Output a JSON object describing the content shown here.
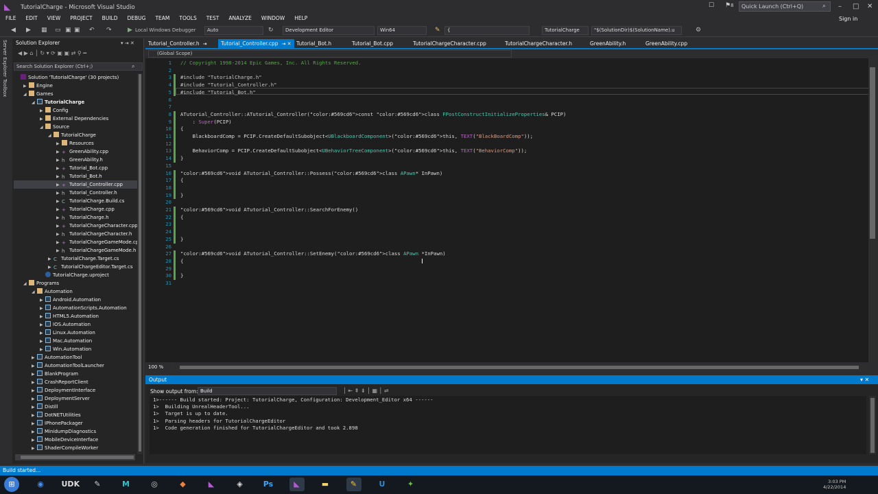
{
  "window": {
    "title": "TutorialCharge - Microsoft Visual Studio",
    "quick_launch": "Quick Launch (Ctrl+Q)",
    "notif_count": "8"
  },
  "menu": [
    "FILE",
    "EDIT",
    "VIEW",
    "PROJECT",
    "BUILD",
    "DEBUG",
    "TEAM",
    "TOOLS",
    "TEST",
    "ANALYZE",
    "WINDOW",
    "HELP"
  ],
  "sign_in": "Sign in",
  "toolbar": {
    "debugger": "Local Windows Debugger",
    "config": "Auto",
    "solution_config": "Development Editor",
    "platform": "Win64",
    "find": "{",
    "project": "TutorialCharge",
    "macro": "\"$(SolutionDir)$(SolutionName).u"
  },
  "side_strip": [
    "Server Explorer",
    "Toolbox"
  ],
  "solution_explorer": {
    "title": "Solution Explorer",
    "search_placeholder": "Search Solution Explorer (Ctrl+;)",
    "nodes": [
      {
        "label": "Solution 'TutorialCharge' (30 projects)",
        "icon": "sln",
        "depth": 0,
        "exp": ""
      },
      {
        "label": "Engine",
        "icon": "folder",
        "depth": 1,
        "exp": "▶"
      },
      {
        "label": "Games",
        "icon": "folder",
        "depth": 1,
        "exp": "◢"
      },
      {
        "label": "TutorialCharge",
        "icon": "proj",
        "depth": 2,
        "exp": "◢",
        "bold": true
      },
      {
        "label": "Config",
        "icon": "folder",
        "depth": 3,
        "exp": "▶"
      },
      {
        "label": "External Dependencies",
        "icon": "folder",
        "depth": 3,
        "exp": "▶"
      },
      {
        "label": "Source",
        "icon": "folder",
        "depth": 3,
        "exp": "◢"
      },
      {
        "label": "TutorialCharge",
        "icon": "folder",
        "depth": 4,
        "exp": "◢"
      },
      {
        "label": "Resources",
        "icon": "folder",
        "depth": 5,
        "exp": "▶"
      },
      {
        "label": "GreenAbility.cpp",
        "icon": "cpp",
        "depth": 5,
        "exp": "▶"
      },
      {
        "label": "GreenAbility.h",
        "icon": "h",
        "depth": 5,
        "exp": "▶"
      },
      {
        "label": "Tutorial_Bot.cpp",
        "icon": "cpp",
        "depth": 5,
        "exp": "▶"
      },
      {
        "label": "Tutorial_Bot.h",
        "icon": "h",
        "depth": 5,
        "exp": "▶"
      },
      {
        "label": "Tutorial_Controller.cpp",
        "icon": "cpp",
        "depth": 5,
        "exp": "▶",
        "selected": true
      },
      {
        "label": "Tutorial_Controller.h",
        "icon": "h",
        "depth": 5,
        "exp": "▶"
      },
      {
        "label": "TutorialCharge.Build.cs",
        "icon": "cs",
        "depth": 5,
        "exp": "▶"
      },
      {
        "label": "TutorialCharge.cpp",
        "icon": "cpp",
        "depth": 5,
        "exp": "▶"
      },
      {
        "label": "TutorialCharge.h",
        "icon": "h",
        "depth": 5,
        "exp": "▶"
      },
      {
        "label": "TutorialChargeCharacter.cpp",
        "icon": "cpp",
        "depth": 5,
        "exp": "▶"
      },
      {
        "label": "TutorialChargeCharacter.h",
        "icon": "h",
        "depth": 5,
        "exp": "▶"
      },
      {
        "label": "TutorialChargeGameMode.cpp",
        "icon": "cpp",
        "depth": 5,
        "exp": "▶"
      },
      {
        "label": "TutorialChargeGameMode.h",
        "icon": "h",
        "depth": 5,
        "exp": "▶"
      },
      {
        "label": "TutorialCharge.Target.cs",
        "icon": "cs",
        "depth": 4,
        "exp": "▶"
      },
      {
        "label": "TutorialChargeEditor.Target.cs",
        "icon": "cs",
        "depth": 4,
        "exp": "▶"
      },
      {
        "label": "TutorialCharge.uproject",
        "icon": "up",
        "depth": 3,
        "exp": ""
      },
      {
        "label": "Programs",
        "icon": "folder",
        "depth": 1,
        "exp": "◢"
      },
      {
        "label": "Automation",
        "icon": "folder",
        "depth": 2,
        "exp": "◢"
      },
      {
        "label": "Android.Automation",
        "icon": "proj",
        "depth": 3,
        "exp": "▶"
      },
      {
        "label": "AutomationScripts.Automation",
        "icon": "proj",
        "depth": 3,
        "exp": "▶"
      },
      {
        "label": "HTML5.Automation",
        "icon": "proj",
        "depth": 3,
        "exp": "▶"
      },
      {
        "label": "IOS.Automation",
        "icon": "proj",
        "depth": 3,
        "exp": "▶"
      },
      {
        "label": "Linux.Automation",
        "icon": "proj",
        "depth": 3,
        "exp": "▶"
      },
      {
        "label": "Mac.Automation",
        "icon": "proj",
        "depth": 3,
        "exp": "▶"
      },
      {
        "label": "Win.Automation",
        "icon": "proj",
        "depth": 3,
        "exp": "▶"
      },
      {
        "label": "AutomationTool",
        "icon": "proj",
        "depth": 2,
        "exp": "▶"
      },
      {
        "label": "AutomationToolLauncher",
        "icon": "proj",
        "depth": 2,
        "exp": "▶"
      },
      {
        "label": "BlankProgram",
        "icon": "proj",
        "depth": 2,
        "exp": "▶"
      },
      {
        "label": "CrashReportClient",
        "icon": "proj",
        "depth": 2,
        "exp": "▶"
      },
      {
        "label": "DeploymentInterface",
        "icon": "proj",
        "depth": 2,
        "exp": "▶"
      },
      {
        "label": "DeploymentServer",
        "icon": "proj",
        "depth": 2,
        "exp": "▶"
      },
      {
        "label": "Distill",
        "icon": "proj",
        "depth": 2,
        "exp": "▶"
      },
      {
        "label": "DotNETUtilities",
        "icon": "proj",
        "depth": 2,
        "exp": "▶"
      },
      {
        "label": "IPhonePackager",
        "icon": "proj",
        "depth": 2,
        "exp": "▶"
      },
      {
        "label": "MinidumpDiagnostics",
        "icon": "proj",
        "depth": 2,
        "exp": "▶"
      },
      {
        "label": "MobileDeviceInterface",
        "icon": "proj",
        "depth": 2,
        "exp": "▶"
      },
      {
        "label": "ShaderCompileWorker",
        "icon": "proj",
        "depth": 2,
        "exp": "▶"
      }
    ]
  },
  "tabs": [
    {
      "label": "Tutorial_Controller.h",
      "suffix": "⇥"
    },
    {
      "label": "Tutorial_Controller.cpp",
      "suffix": "⇥ ✕",
      "active": true
    },
    {
      "label": "Tutorial_Bot.h",
      "suffix": ""
    },
    {
      "label": "Tutorial_Bot.cpp",
      "suffix": ""
    },
    {
      "label": "TutorialChargeCharacter.cpp",
      "suffix": ""
    },
    {
      "label": "TutorialChargeCharacter.h",
      "suffix": ""
    },
    {
      "label": "GreenAbility.h",
      "suffix": ""
    },
    {
      "label": "GreenAbility.cpp",
      "suffix": ""
    }
  ],
  "scope": "(Global Scope)",
  "code_lines": [
    "// Copyright 1998-2014 Epic Games, Inc. All Rights Reserved.",
    "",
    "#include \"TutorialCharge.h\"",
    "#include \"Tutorial_Controller.h\"",
    "#include \"Tutorial_Bot.h\"",
    "",
    "",
    "ATutorial_Controller::ATutorial_Controller(const class FPostConstructInitializeProperties& PCIP)",
    "    : Super(PCIP)",
    "{",
    "    BlackboardComp = PCIP.CreateDefaultSubobject<UBlackboardComponent>(this, TEXT(\"BlackBoardComp\"));",
    "",
    "    BehaviorComp = PCIP.CreateDefaultSubobject<UBehaviorTreeComponent>(this, TEXT(\"BehaviorComp\"));",
    "}",
    "",
    "void ATutorial_Controller::Possess(class APawn* InPawn)",
    "{",
    "",
    "}",
    "",
    "void ATutorial_Controller::SearchForEnemy()",
    "{",
    "",
    "",
    "}",
    "",
    "void ATutorial_Controller::SetEnemy(class APawn *InPawn)",
    "{",
    "",
    "}",
    ""
  ],
  "zoom": "100 %",
  "output": {
    "title": "Output",
    "show_from_label": "Show output from:",
    "source": "Build",
    "lines": [
      "1>------ Build started: Project: TutorialCharge, Configuration: Development_Editor x64 ------",
      "1>  Building UnrealHeaderTool...",
      "1>  Target is up to date.",
      "1>  Parsing headers for TutorialChargeEditor",
      "1>  Code generation finished for TutorialChargeEditor and took 2.898"
    ]
  },
  "status": "Build started...",
  "taskbar": [
    {
      "name": "chrome-icon",
      "glyph": "◉",
      "color": "#4a8df0"
    },
    {
      "name": "udk-icon",
      "glyph": "UDK",
      "color": "#dddddd"
    },
    {
      "name": "notepad-icon",
      "glyph": "✎",
      "color": "#cccccc"
    },
    {
      "name": "maya-icon",
      "glyph": "M",
      "color": "#30c0c8"
    },
    {
      "name": "eye-icon",
      "glyph": "◎",
      "color": "#cccccc"
    },
    {
      "name": "paint-icon",
      "glyph": "◆",
      "color": "#f08040"
    },
    {
      "name": "vs-icon",
      "glyph": "◣",
      "color": "#b45ad3"
    },
    {
      "name": "unity-icon",
      "glyph": "◈",
      "color": "#dddddd"
    },
    {
      "name": "photoshop-icon",
      "glyph": "Ps",
      "color": "#31a8ff"
    },
    {
      "name": "vs2-icon",
      "glyph": "◣",
      "color": "#b45ad3"
    },
    {
      "name": "folder-icon",
      "glyph": "▬",
      "color": "#f4d36b"
    },
    {
      "name": "sticky-icon",
      "glyph": "✎",
      "color": "#f5c542"
    },
    {
      "name": "unreal-icon",
      "glyph": "U",
      "color": "#2a8cd8"
    },
    {
      "name": "game-icon",
      "glyph": "✦",
      "color": "#6bc04b"
    }
  ],
  "clock": {
    "time": "3:03 PM",
    "date": "4/22/2014"
  }
}
